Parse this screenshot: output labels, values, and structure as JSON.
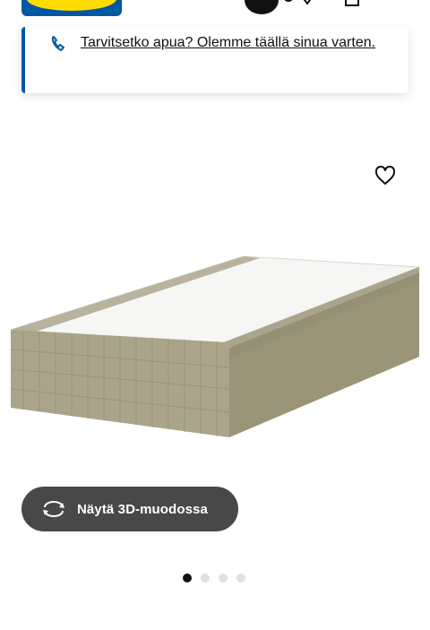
{
  "header": {
    "logo_label": "IKEA"
  },
  "help_banner": {
    "text": "Tarvitsetko apua? Olemme täällä sinua varten."
  },
  "product": {
    "favorite_icon": "heart-outline-icon",
    "image_description_icon": "bed-base-image"
  },
  "view_3d_button": {
    "label": "Näytä 3D-muodossa",
    "icon": "rotate-3d-icon"
  },
  "carousel": {
    "total": 4,
    "active_index": 0
  },
  "colors": {
    "brand_blue": "#0058a3",
    "brand_yellow": "#ffdb00",
    "button_bg": "#484848",
    "dot_active": "#111111",
    "dot_inactive": "#dfdfdf"
  }
}
